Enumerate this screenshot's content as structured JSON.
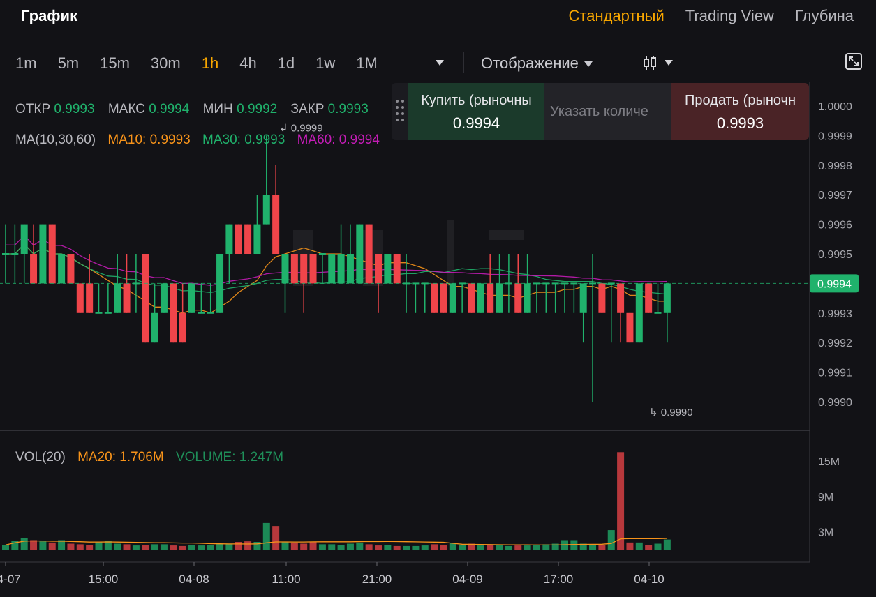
{
  "header": {
    "title": "График",
    "view_tabs": [
      {
        "label": "Стандартный",
        "active": true
      },
      {
        "label": "Trading View",
        "active": false
      },
      {
        "label": "Глубина",
        "active": false
      }
    ]
  },
  "toolbar": {
    "intervals": [
      {
        "label": "1m",
        "active": false
      },
      {
        "label": "5m",
        "active": false
      },
      {
        "label": "15m",
        "active": false
      },
      {
        "label": "30m",
        "active": false
      },
      {
        "label": "1h",
        "active": true
      },
      {
        "label": "4h",
        "active": false
      },
      {
        "label": "1d",
        "active": false
      },
      {
        "label": "1w",
        "active": false
      },
      {
        "label": "1M",
        "active": false
      }
    ],
    "display_label": "Отображение"
  },
  "ohlc": {
    "open_label": "ОТКР",
    "open": "0.9993",
    "high_label": "МАКС",
    "high": "0.9994",
    "low_label": "МИН",
    "low": "0.9992",
    "close_label": "ЗАКР",
    "close": "0.9993"
  },
  "ma": {
    "label": "MA(10,30,60)",
    "ma10": "MA10: 0.9993",
    "ma30": "MA30: 0.9993",
    "ma60": "MA60: 0.9994"
  },
  "volume_legend": {
    "label": "VOL(20)",
    "ma20": "MA20: 1.706M",
    "volume": "VOLUME: 1.247M"
  },
  "trade_panel": {
    "buy_label": "Купить (рыночны",
    "buy_price": "0.9994",
    "qty_placeholder": "Указать количе",
    "sell_label": "Продать (рыночн",
    "sell_price": "0.9993"
  },
  "colors": {
    "up": "#20b26c",
    "down": "#ef454a",
    "accent": "#f7a600",
    "ma10": "#f7931a",
    "ma30": "#20b26c",
    "ma60": "#c41cb6"
  },
  "chart_data": {
    "type": "candlestick",
    "price_axis_ticks": [
      "1.0000",
      "0.9999",
      "0.9998",
      "0.9997",
      "0.9996",
      "0.9995",
      "0.9994",
      "0.9993",
      "0.9992",
      "0.9991",
      "0.9990"
    ],
    "volume_axis_ticks": [
      "15M",
      "9M",
      "3M"
    ],
    "time_ticks": [
      "04-07",
      "15:00",
      "04-08",
      "11:00",
      "21:00",
      "04-09",
      "17:00",
      "04-10"
    ],
    "current_price": "0.9994",
    "max_annotation": "0.9999",
    "min_annotation": "0.9990",
    "candles": [
      [
        0.9995,
        0.9996,
        0.9994,
        0.9995
      ],
      [
        0.9995,
        0.9996,
        0.9994,
        0.9995
      ],
      [
        0.9995,
        0.9996,
        0.9994,
        0.9996
      ],
      [
        0.9995,
        0.9996,
        0.9994,
        0.9994
      ],
      [
        0.9994,
        0.9996,
        0.9994,
        0.9996
      ],
      [
        0.9996,
        0.9996,
        0.9994,
        0.9994
      ],
      [
        0.9994,
        0.9995,
        0.9994,
        0.9995
      ],
      [
        0.9995,
        0.9995,
        0.9994,
        0.9994
      ],
      [
        0.9994,
        0.9994,
        0.9993,
        0.9993
      ],
      [
        0.9994,
        0.9995,
        0.9993,
        0.9993
      ],
      [
        0.9993,
        0.9994,
        0.9993,
        0.9993
      ],
      [
        0.9993,
        0.9994,
        0.9993,
        0.9993
      ],
      [
        0.9993,
        0.9995,
        0.9993,
        0.9994
      ],
      [
        0.9994,
        0.9995,
        0.9993,
        0.9993
      ],
      [
        0.9994,
        0.9995,
        0.9993,
        0.9994
      ],
      [
        0.9995,
        0.9995,
        0.9992,
        0.9992
      ],
      [
        0.9992,
        0.9994,
        0.9992,
        0.9993
      ],
      [
        0.9993,
        0.9994,
        0.9993,
        0.9994
      ],
      [
        0.9994,
        0.9994,
        0.9992,
        0.9992
      ],
      [
        0.9993,
        0.9994,
        0.9992,
        0.9992
      ],
      [
        0.9993,
        0.9994,
        0.9993,
        0.9994
      ],
      [
        0.9993,
        0.9994,
        0.9993,
        0.9993
      ],
      [
        0.9993,
        0.9994,
        0.9993,
        0.9993
      ],
      [
        0.9993,
        0.9995,
        0.9993,
        0.9995
      ],
      [
        0.9995,
        0.9996,
        0.9994,
        0.9996
      ],
      [
        0.9996,
        0.9996,
        0.9995,
        0.9995
      ],
      [
        0.9996,
        0.9996,
        0.9995,
        0.9995
      ],
      [
        0.9995,
        0.9997,
        0.9995,
        0.9996
      ],
      [
        0.9996,
        0.9999,
        0.9996,
        0.9997
      ],
      [
        0.9997,
        0.9998,
        0.9995,
        0.9995
      ],
      [
        0.9994,
        0.9995,
        0.9993,
        0.9995
      ],
      [
        0.9995,
        0.9995,
        0.9994,
        0.9994
      ],
      [
        0.9995,
        0.9995,
        0.9993,
        0.9994
      ],
      [
        0.9995,
        0.9995,
        0.9994,
        0.9994
      ],
      [
        0.9995,
        0.9995,
        0.9994,
        0.9995
      ],
      [
        0.9994,
        0.9995,
        0.9994,
        0.9995
      ],
      [
        0.9994,
        0.9996,
        0.9994,
        0.9995
      ],
      [
        0.9994,
        0.9996,
        0.9994,
        0.9995
      ],
      [
        0.9994,
        0.9996,
        0.9994,
        0.9996
      ],
      [
        0.9996,
        0.9996,
        0.9994,
        0.9994
      ],
      [
        0.9995,
        0.9995,
        0.9993,
        0.9994
      ],
      [
        0.9994,
        0.9995,
        0.9994,
        0.9995
      ],
      [
        0.9995,
        0.9995,
        0.9994,
        0.9994
      ],
      [
        0.9994,
        0.9995,
        0.9993,
        0.9994
      ],
      [
        0.9994,
        0.9994,
        0.9993,
        0.9994
      ],
      [
        0.9994,
        0.9994,
        0.9993,
        0.9994
      ],
      [
        0.9994,
        0.9994,
        0.9993,
        0.9993
      ],
      [
        0.9994,
        0.9994,
        0.9993,
        0.9993
      ],
      [
        0.9993,
        0.9994,
        0.9993,
        0.9994
      ],
      [
        0.9994,
        0.9994,
        0.9993,
        0.9994
      ],
      [
        0.9994,
        0.9994,
        0.9993,
        0.9993
      ],
      [
        0.9993,
        0.9994,
        0.9993,
        0.9994
      ],
      [
        0.9994,
        0.9995,
        0.9993,
        0.9993
      ],
      [
        0.9993,
        0.9995,
        0.9993,
        0.9994
      ],
      [
        0.9994,
        0.9995,
        0.9993,
        0.9994
      ],
      [
        0.9994,
        0.9995,
        0.9993,
        0.9993
      ],
      [
        0.9993,
        0.9995,
        0.9993,
        0.9994
      ],
      [
        0.9994,
        0.9994,
        0.9993,
        0.9994
      ],
      [
        0.9994,
        0.9994,
        0.9993,
        0.9994
      ],
      [
        0.9994,
        0.9994,
        0.9993,
        0.9994
      ],
      [
        0.9994,
        0.9994,
        0.9993,
        0.9994
      ],
      [
        0.9994,
        0.9994,
        0.9993,
        0.9994
      ],
      [
        0.9993,
        0.9994,
        0.9992,
        0.9994
      ],
      [
        0.9994,
        0.9995,
        0.999,
        0.9994
      ],
      [
        0.9994,
        0.9994,
        0.9993,
        0.9993
      ],
      [
        0.9994,
        0.9994,
        0.9992,
        0.9994
      ],
      [
        0.9994,
        0.9994,
        0.9992,
        0.9993
      ],
      [
        0.9993,
        0.9993,
        0.9992,
        0.9992
      ],
      [
        0.9992,
        0.9994,
        0.9992,
        0.9994
      ],
      [
        0.9994,
        0.9994,
        0.9993,
        0.9993
      ],
      [
        0.9993,
        0.9994,
        0.9993,
        0.9993
      ],
      [
        0.9993,
        0.9994,
        0.9992,
        0.9994
      ]
    ],
    "volumes_m": [
      0.8,
      1.5,
      2.0,
      1.6,
      1.4,
      1.2,
      1.6,
      1.0,
      0.9,
      0.8,
      1.3,
      1.5,
      1.0,
      0.9,
      0.7,
      0.8,
      0.9,
      0.9,
      0.7,
      0.6,
      0.8,
      0.7,
      0.8,
      1.0,
      1.0,
      1.3,
      1.4,
      1.3,
      4.5,
      4.0,
      1.3,
      1.2,
      1.0,
      1.3,
      0.9,
      0.9,
      0.8,
      1.0,
      1.2,
      0.9,
      0.7,
      0.8,
      0.6,
      0.6,
      0.6,
      0.7,
      0.9,
      0.8,
      1.1,
      0.8,
      1.0,
      0.7,
      0.8,
      0.8,
      0.6,
      0.7,
      0.7,
      0.8,
      0.9,
      1.0,
      1.6,
      1.6,
      1.0,
      0.9,
      0.8,
      3.3,
      16.5,
      1.2,
      1.2,
      0.8,
      1.0,
      1.7,
      1.3,
      0.8,
      1.3
    ]
  }
}
